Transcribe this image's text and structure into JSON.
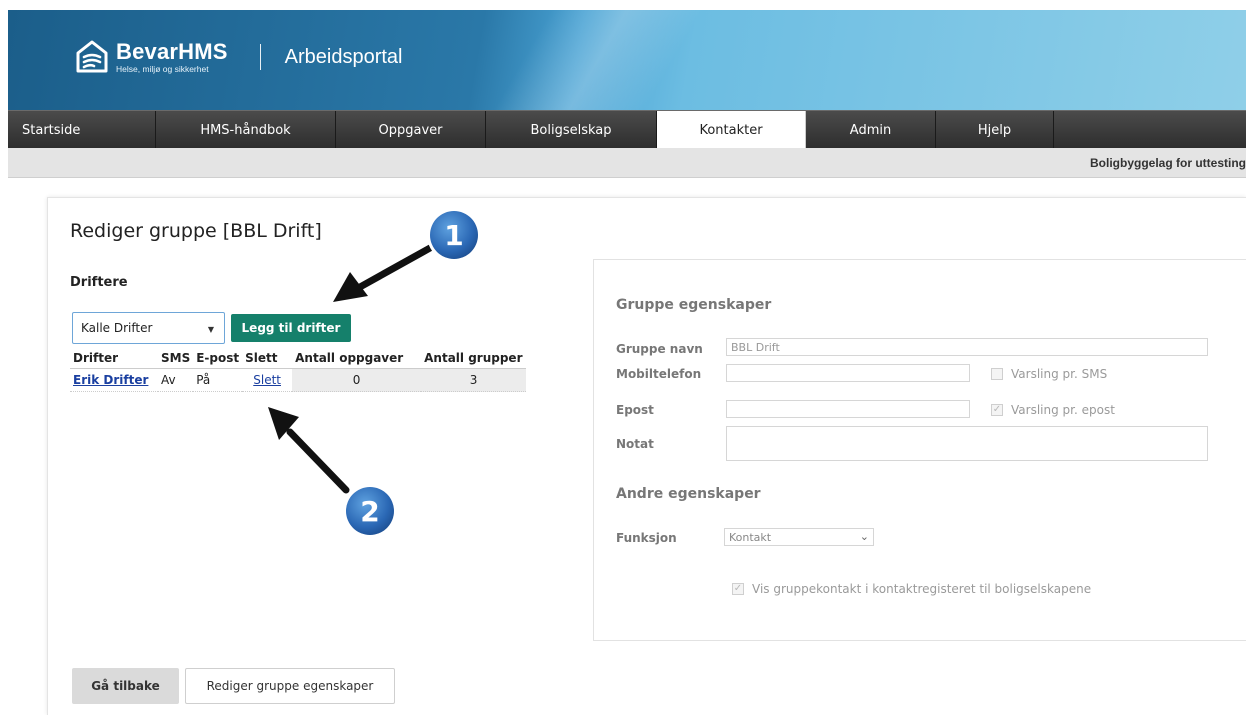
{
  "header": {
    "brand_name": "BevarHMS",
    "brand_tagline": "Helse, miljø og sikkerhet",
    "portal_title": "Arbeidsportal"
  },
  "nav": {
    "items": [
      {
        "label": "Startside"
      },
      {
        "label": "HMS-håndbok"
      },
      {
        "label": "Oppgaver"
      },
      {
        "label": "Boligselskap"
      },
      {
        "label": "Kontakter",
        "active": true
      },
      {
        "label": "Admin"
      },
      {
        "label": "Hjelp"
      }
    ]
  },
  "subbar": {
    "organization": "Boligbyggelag for uttesting"
  },
  "page": {
    "title": "Rediger gruppe [BBL Drift]",
    "section_title": "Driftere",
    "driver_select_value": "Kalle Drifter",
    "add_button": "Legg til drifter"
  },
  "drivers_table": {
    "headers": [
      "Drifter",
      "SMS",
      "E-post",
      "Slett",
      "Antall oppgaver",
      "Antall grupper"
    ],
    "rows": [
      {
        "name": "Erik Drifter",
        "sms": "Av",
        "email": "På",
        "delete": "Slett",
        "tasks": "0",
        "groups": "3"
      }
    ]
  },
  "properties": {
    "heading": "Gruppe egenskaper",
    "group_name_label": "Gruppe navn",
    "group_name_value": "BBL Drift",
    "mobile_label": "Mobiltelefon",
    "mobile_value": "",
    "sms_notify_label": "Varsling pr. SMS",
    "sms_notify_checked": false,
    "email_label": "Epost",
    "email_value": "",
    "email_notify_label": "Varsling pr. epost",
    "email_notify_checked": true,
    "note_label": "Notat",
    "other_heading": "Andre egenskaper",
    "function_label": "Funksjon",
    "function_value": "Kontakt",
    "show_contact_label": "Vis gruppekontakt i kontaktregisteret til boligselskapene",
    "show_contact_checked": true
  },
  "footer": {
    "back_button": "Gå tilbake",
    "edit_button": "Rediger gruppe egenskaper"
  },
  "annotations": {
    "badge_1": "1",
    "badge_2": "2"
  },
  "colors": {
    "add_button": "#15806b",
    "link": "#1a3fa0",
    "nav_bg": "#3a3a3a",
    "annotation_badge": "#2a67b4"
  }
}
